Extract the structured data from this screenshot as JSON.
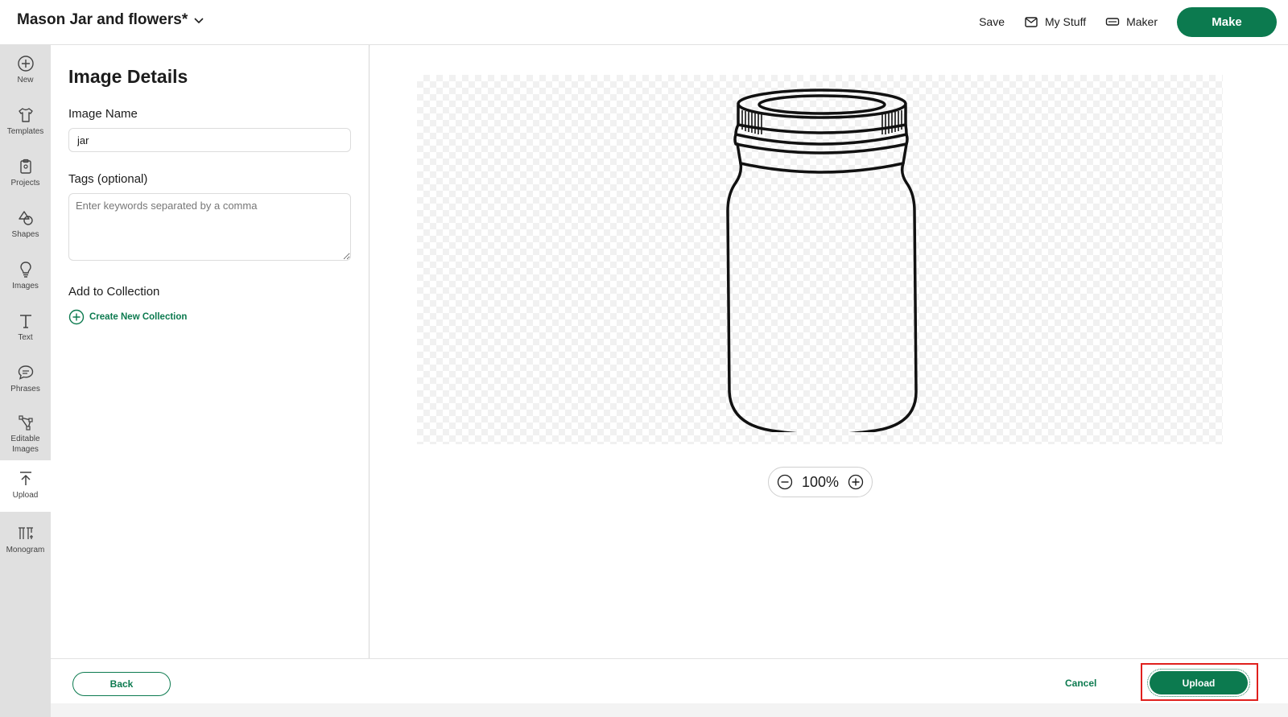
{
  "header": {
    "project_title": "Mason Jar and flowers*",
    "save_label": "Save",
    "my_stuff_label": "My Stuff",
    "maker_label": "Maker",
    "make_label": "Make"
  },
  "sidebar": {
    "items": [
      {
        "label": "New",
        "icon": "plus-circle-icon"
      },
      {
        "label": "Templates",
        "icon": "shirt-icon"
      },
      {
        "label": "Projects",
        "icon": "clipboard-icon"
      },
      {
        "label": "Shapes",
        "icon": "shapes-icon"
      },
      {
        "label": "Images",
        "icon": "lightbulb-icon"
      },
      {
        "label": "Text",
        "icon": "text-icon"
      },
      {
        "label": "Phrases",
        "icon": "speech-bubble-icon"
      },
      {
        "label": "Editable Images",
        "icon": "editable-image-icon"
      },
      {
        "label": "Upload",
        "icon": "upload-icon"
      },
      {
        "label": "Monogram",
        "icon": "monogram-icon"
      }
    ],
    "active": "Upload"
  },
  "details": {
    "title": "Image Details",
    "image_name_label": "Image Name",
    "image_name_value": "jar",
    "tags_label": "Tags (optional)",
    "tags_placeholder": "Enter keywords separated by a comma",
    "collection_label": "Add to Collection",
    "create_collection_label": "Create New Collection"
  },
  "canvas": {
    "zoom_level": "100%"
  },
  "footer": {
    "back_label": "Back",
    "cancel_label": "Cancel",
    "upload_label": "Upload"
  },
  "colors": {
    "accent": "#0c7a4f",
    "sidebar_bg": "#e0e0e0",
    "highlight": "#e0201d"
  }
}
